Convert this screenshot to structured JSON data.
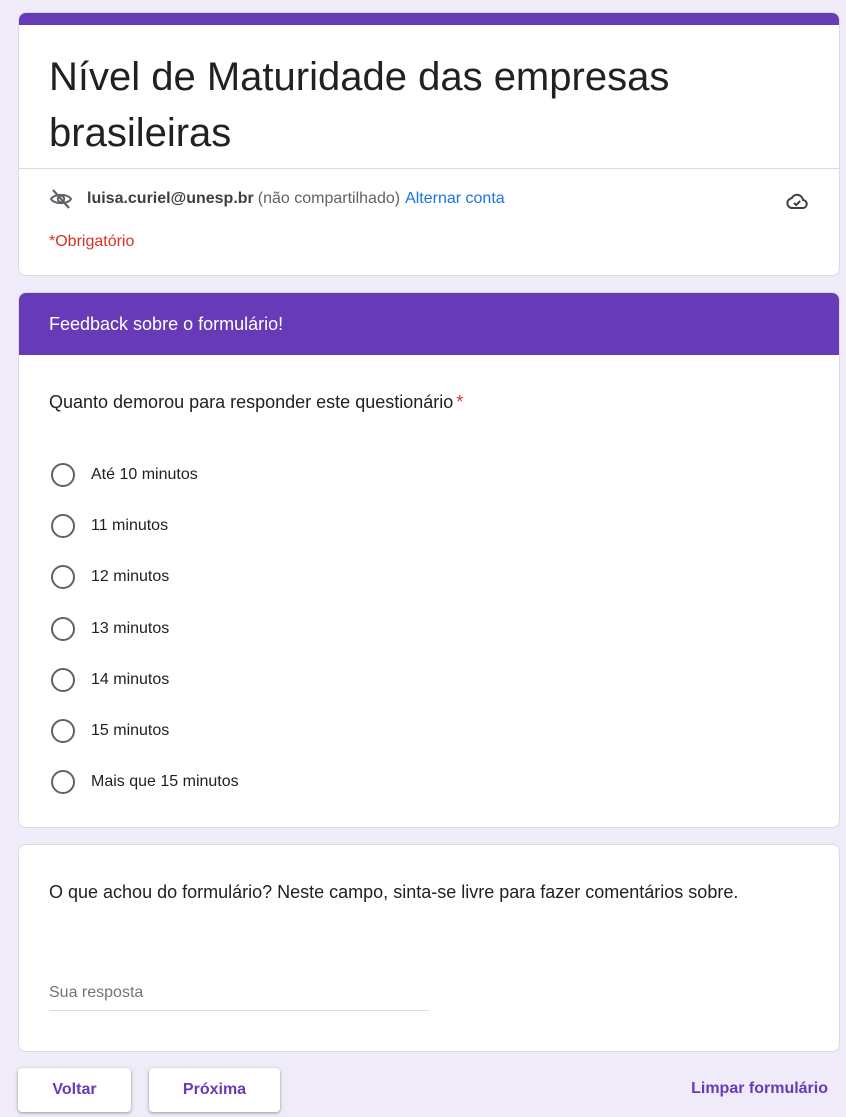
{
  "form": {
    "title": "Nível de Maturidade das empresas brasileiras",
    "account_email": "luisa.curiel@unesp.br",
    "account_note": "(não compartilhado)",
    "switch_account": "Alternar conta",
    "required_note": "*Obrigatório",
    "accent_color": "#673ab7",
    "icons": {
      "account_hidden": "visibility-off-icon",
      "cloud_status": "cloud-done-icon"
    }
  },
  "section": {
    "title": "Feedback sobre o formulário!",
    "question": "Quanto demorou para responder este questionário",
    "required_marker": "*",
    "options": [
      "Até 10 minutos",
      "11 minutos",
      "12 minutos",
      "13 minutos",
      "14 minutos",
      "15 minutos",
      "Mais que 15 minutos"
    ]
  },
  "comment": {
    "question": "O que achou do formulário? Neste campo, sinta-se livre para fazer comentários sobre.",
    "placeholder": "Sua resposta",
    "value": ""
  },
  "nav": {
    "back": "Voltar",
    "next": "Próxima",
    "clear": "Limpar formulário"
  }
}
